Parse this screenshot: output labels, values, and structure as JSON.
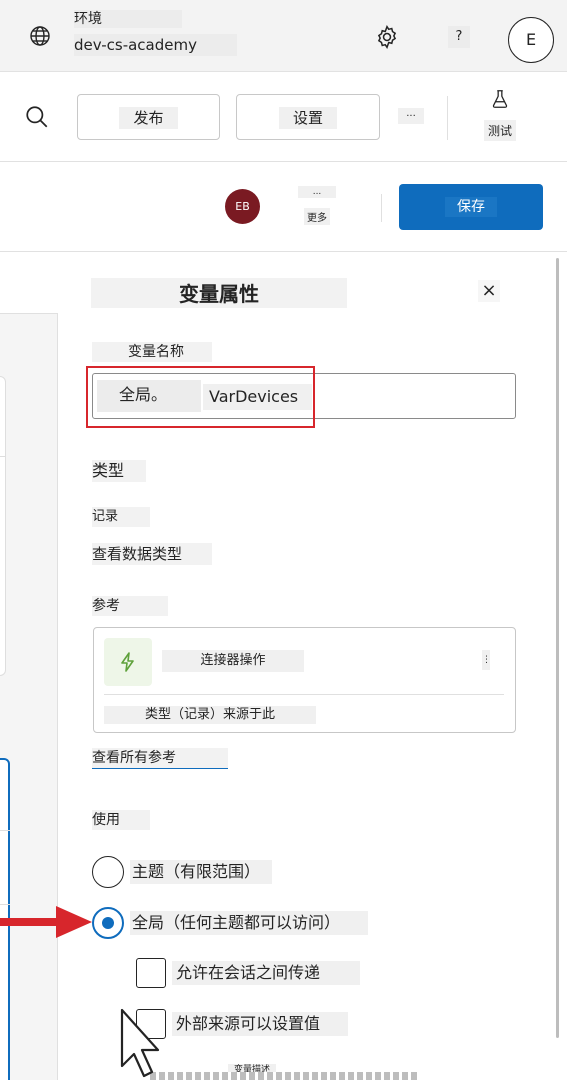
{
  "environment": {
    "label": "环境",
    "name": "dev-cs-academy",
    "help_label": "?",
    "user_initial": "E"
  },
  "command_bar": {
    "publish_label": "发布",
    "settings_label": "设置",
    "more_label": "...",
    "test_label": "测试"
  },
  "save_bar": {
    "user_initials": "EB",
    "more_dots": "...",
    "more_label": "更多",
    "save_label": "保存"
  },
  "panel": {
    "title": "变量属性",
    "close_label": "×",
    "variable_name_label": "变量名称",
    "scope_prefix": "全局。",
    "variable_name_value": "VarDevices",
    "type_label": "类型",
    "type_value": "记录",
    "view_data_type_label": "查看数据类型",
    "references_label": "参考",
    "reference_card": {
      "name": "连接器操作",
      "menu_label": "⋮",
      "source_text": "类型（记录）来源于此"
    },
    "view_all_references_label": "查看所有参考",
    "usage_label": "使用",
    "options": {
      "topic_label": "主题（有限范围）",
      "global_label": "全局（任何主题都可以访问）",
      "selected": "global"
    },
    "checkboxes": {
      "pass_between_sessions_label": "允许在会话之间传递",
      "external_sources_label": "外部来源可以设置值"
    },
    "description_label": "变量描述"
  },
  "colors": {
    "accent": "#0f6cbd",
    "annotation_red": "#d7262c",
    "avatar_bg": "#7a1a22",
    "connector_icon_green": "#5ea13a"
  }
}
